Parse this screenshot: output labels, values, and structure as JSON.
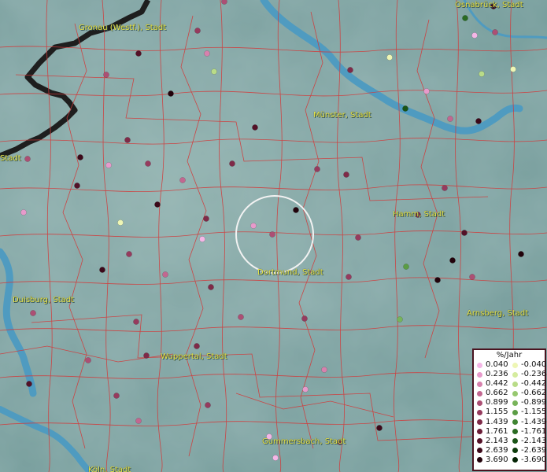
{
  "cities": [
    {
      "name": "Osnabrück, Stadt"
    },
    {
      "name": "Gronau (Westf.), Stadt"
    },
    {
      "name": "Münster, Stadt"
    },
    {
      "name": "Stadt"
    },
    {
      "name": "Hamm, Stadt"
    },
    {
      "name": "Dortmund, Stadt"
    },
    {
      "name": "Duisburg, Stadt"
    },
    {
      "name": "Arnsberg, Stadt"
    },
    {
      "name": "Wuppertal, Stadt"
    },
    {
      "name": "Gummersbach, Stadt"
    },
    {
      "name": "Köln, Stadt"
    }
  ],
  "legend": {
    "title": "%/Jahr",
    "positive": [
      {
        "label": "0.040",
        "color": "#f4b6e6"
      },
      {
        "label": "0.236",
        "color": "#e79acb"
      },
      {
        "label": "0.442",
        "color": "#d781ad"
      },
      {
        "label": "0.662",
        "color": "#c26790"
      },
      {
        "label": "0.899",
        "color": "#ac4f74"
      },
      {
        "label": "1.155",
        "color": "#963b5e"
      },
      {
        "label": "1.439",
        "color": "#7f2a48"
      },
      {
        "label": "1.761",
        "color": "#6a1c36"
      },
      {
        "label": "2.143",
        "color": "#541127"
      },
      {
        "label": "2.639",
        "color": "#3c0819"
      },
      {
        "label": "3.690",
        "color": "#22020b"
      }
    ],
    "negative": [
      {
        "label": "-0.040",
        "color": "#eef6b5"
      },
      {
        "label": "-0.236",
        "color": "#d5ec9f"
      },
      {
        "label": "-0.442",
        "color": "#b9dc88"
      },
      {
        "label": "-0.662",
        "color": "#97c870"
      },
      {
        "label": "-0.899",
        "color": "#78b45a"
      },
      {
        "label": "-1.155",
        "color": "#5b9d45"
      },
      {
        "label": "-1.439",
        "color": "#3f8432"
      },
      {
        "label": "-1.761",
        "color": "#2a6b22"
      },
      {
        "label": "-2.143",
        "color": "#1a5416"
      },
      {
        "label": "-2.639",
        "color": "#0d3c0b"
      },
      {
        "label": "-3.690",
        "color": "#042404"
      }
    ]
  },
  "stations": [
    [
      "#ac4f74",
      0
    ],
    [
      "#3c0819",
      0
    ],
    [
      "#2a6b22",
      0
    ],
    [
      "#ac4f74",
      0
    ],
    [
      "#f4b6e6",
      0
    ],
    [
      "#eef6b5",
      0
    ],
    [
      "#b9dc88",
      0
    ],
    [
      "#963b5e",
      0
    ],
    [
      "#d781ad",
      0
    ],
    [
      "#541127",
      0
    ],
    [
      "#22020b",
      0
    ],
    [
      "#ac4f74",
      0
    ],
    [
      "#b9dc88",
      0
    ],
    [
      "#eef6b5",
      0
    ],
    [
      "#7f2a48",
      0
    ],
    [
      "#e79acb",
      0
    ],
    [
      "#1a5416",
      0
    ],
    [
      "#3c0819",
      0
    ],
    [
      "#c26790",
      0
    ],
    [
      "#541127",
      0
    ],
    [
      "#7f2a48",
      0
    ],
    [
      "#963b5e",
      0
    ],
    [
      "#3c0819",
      0
    ],
    [
      "#e79acb",
      0
    ],
    [
      "#ac4f74",
      0
    ],
    [
      "#7f2a48",
      0
    ],
    [
      "#3c0819",
      0
    ],
    [
      "#c26790",
      0
    ],
    [
      "#7f2a48",
      0
    ],
    [
      "#963b5e",
      0
    ],
    [
      "#541127",
      0
    ],
    [
      "#22020b",
      0
    ],
    [
      "#963b5e",
      0
    ],
    [
      "#ac4f74",
      0
    ],
    [
      "#eef6b5",
      0
    ],
    [
      "#7f2a48",
      0
    ],
    [
      "#e79acb",
      0
    ],
    [
      "#f4b6e6",
      0
    ],
    [
      "#963b5e",
      0
    ],
    [
      "#3c0819",
      0
    ],
    [
      "#7f2a48",
      0
    ],
    [
      "#22020b",
      0
    ],
    [
      "#5b9d45",
      0
    ],
    [
      "#963b5e",
      0
    ],
    [
      "#541127",
      0
    ],
    [
      "#ac4f74",
      0
    ],
    [
      "#c26790",
      0
    ],
    [
      "#7f2a48",
      0
    ],
    [
      "#963b5e",
      0
    ],
    [
      "#22020b",
      0
    ],
    [
      "#963b5e",
      0
    ],
    [
      "#78b45a",
      0
    ],
    [
      "#ac4f74",
      0
    ],
    [
      "#d781ad",
      0
    ],
    [
      "#963b5e",
      0
    ],
    [
      "#7f2a48",
      0
    ],
    [
      "#e79acb",
      0
    ],
    [
      "#963b5e",
      0
    ],
    [
      "#f4b6e6",
      0
    ],
    [
      "#541127",
      0
    ],
    [
      "#ac4f74",
      0
    ],
    [
      "#7f2a48",
      0
    ],
    [
      "#3c0819",
      0
    ],
    [
      "#e79acb",
      0
    ],
    [
      "#ac4f74",
      0
    ],
    [
      "#22020b",
      0
    ],
    [
      "#c26790",
      0
    ],
    [
      "#963b5e",
      0
    ],
    [
      "#7f2a48",
      0
    ],
    [
      "#f4b6e6",
      0
    ]
  ]
}
